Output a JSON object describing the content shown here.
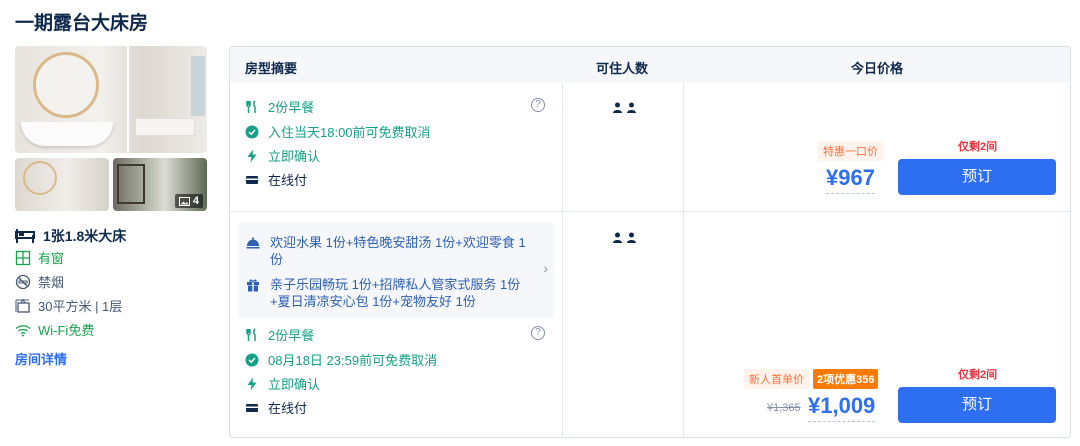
{
  "room": {
    "title": "一期露台大床房",
    "photo_count": "4",
    "bed": "1张1.8米大床",
    "features": [
      {
        "label": "有窗",
        "icon": "window-icon"
      },
      {
        "label": "禁烟",
        "icon": "no-smoking-icon"
      },
      {
        "label": "30平方米 | 1层",
        "icon": "area-icon"
      },
      {
        "label": "Wi-Fi免费",
        "icon": "wifi-icon"
      }
    ],
    "detail_link": "房间详情"
  },
  "table": {
    "headers": {
      "summary": "房型摘要",
      "guests": "可住人数",
      "price": "今日价格"
    },
    "rows": [
      {
        "breakfast": "2份早餐",
        "help": "?",
        "cancel": "入住当天18:00前可免费取消",
        "confirm": "立即确认",
        "payment": "在线付",
        "guests": 2,
        "promo_label": "特惠一口价",
        "price": "¥967",
        "rooms_left": "仅剩2间",
        "book_label": "预订"
      },
      {
        "package": [
          {
            "icon": "dish-icon",
            "text": "欢迎水果 1份+特色晚安甜汤 1份+欢迎零食 1份"
          },
          {
            "icon": "gift-icon",
            "text": "亲子乐园畅玩 1份+招牌私人管家式服务 1份+夏日清凉安心包 1份+宠物友好 1份"
          }
        ],
        "breakfast": "2份早餐",
        "help": "?",
        "cancel": "08月18日 23:59前可免费取消",
        "confirm": "立即确认",
        "payment": "在线付",
        "guests": 2,
        "promo_label": "新人首单价",
        "deal_badge": "2项优惠356",
        "original_price": "¥1,365",
        "price": "¥1,009",
        "rooms_left": "仅剩2间",
        "book_label": "预订"
      }
    ]
  },
  "colors": {
    "accent": "#2d6ff0",
    "green": "#16a085",
    "warn": "#e8323c",
    "promo": "#ff6f3c"
  }
}
